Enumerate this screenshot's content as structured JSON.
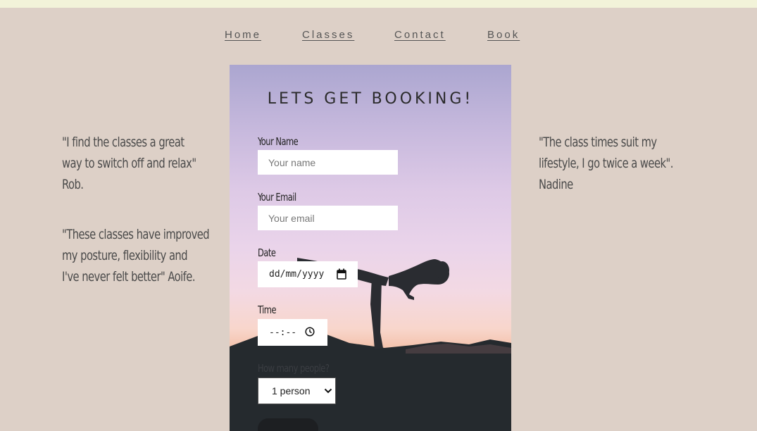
{
  "nav": {
    "items": [
      {
        "label": "Home"
      },
      {
        "label": "Classes"
      },
      {
        "label": "Contact"
      },
      {
        "label": "Book"
      }
    ]
  },
  "testimonials": {
    "left": [
      {
        "lines": [
          "\"I find the classes a great",
          "way to switch off and relax\"",
          "Rob."
        ]
      },
      {
        "lines": [
          "\"These classes have improved",
          "my posture, flexibility and",
          "I've never felt better\" Aoife."
        ]
      }
    ],
    "right": [
      {
        "lines": [
          "\"The class times suit my",
          "lifestyle, I go twice a week\".",
          "Nadine"
        ]
      }
    ]
  },
  "booking": {
    "title": "LETS GET BOOKING!",
    "name": {
      "label": "Your Name",
      "placeholder": "Your name",
      "value": ""
    },
    "email": {
      "label": "Your Email",
      "placeholder": "Your email",
      "value": ""
    },
    "date": {
      "label": "Date",
      "value": "dd/mm/yyyy",
      "icon": "calendar-icon"
    },
    "time": {
      "label": "Time",
      "value": "--:--",
      "icon": "clock-icon"
    },
    "people": {
      "label": "How many people?",
      "selected": "1 person",
      "icon": "chevron-down-icon"
    }
  },
  "colors": {
    "page_background": "#ddd0c7",
    "top_strip": "#f2f3d9",
    "text": "#4a4a4a",
    "card_sky_top": "#aba6d0",
    "card_ground": "#23272b"
  }
}
